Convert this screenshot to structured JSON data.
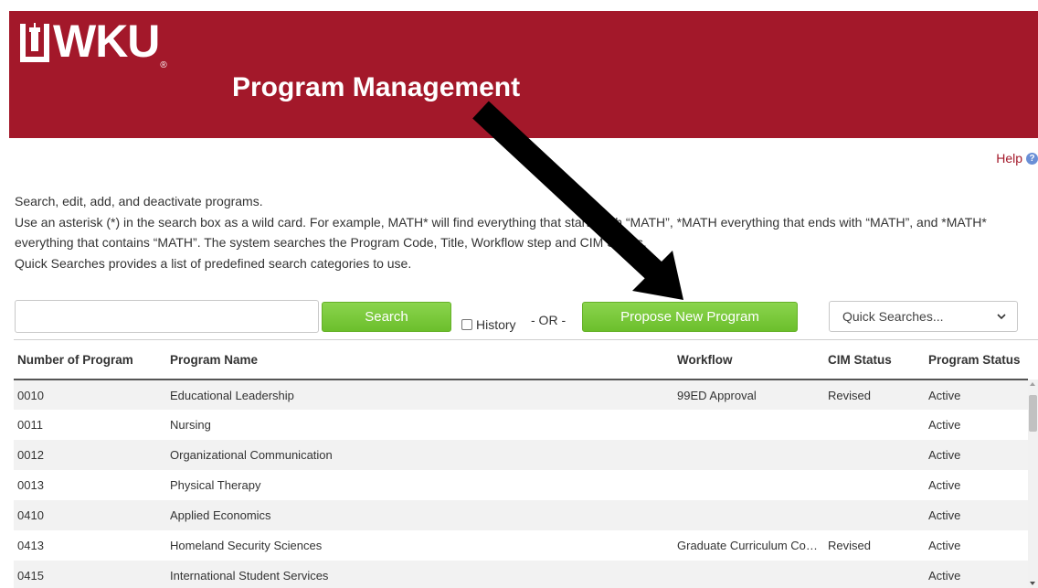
{
  "header": {
    "logo_text": "WKU",
    "logo_reg": "®",
    "title": "Program Management"
  },
  "help": {
    "label": "Help",
    "icon_glyph": "?"
  },
  "intro": {
    "line1": "Search, edit, add, and deactivate programs.",
    "line2": "Use an asterisk (*) in the search box as a wild card. For example, MATH* will find everything that starts with “MATH”, *MATH everything that ends with “MATH”, and *MATH* everything that contains “MATH”. The system searches the Program Code, Title, Workflow step and CIM Status.",
    "line3": "Quick Searches provides a list of predefined search categories to use."
  },
  "search": {
    "value": "",
    "button_label": "Search",
    "history_label": "History",
    "history_checked": false,
    "or_label": "- OR -",
    "propose_label": "Propose New Program",
    "quick_searches_label": "Quick Searches..."
  },
  "table": {
    "headers": [
      "Number of Program",
      "Program Name",
      "Workflow",
      "CIM Status",
      "Program Status"
    ],
    "rows": [
      [
        "0010",
        "Educational Leadership",
        "99ED Approval",
        "Revised",
        "Active"
      ],
      [
        "0011",
        "Nursing",
        "",
        "",
        "Active"
      ],
      [
        "0012",
        "Organizational Communication",
        "",
        "",
        "Active"
      ],
      [
        "0013",
        "Physical Therapy",
        "",
        "",
        "Active"
      ],
      [
        "0410",
        "Applied Economics",
        "",
        "",
        "Active"
      ],
      [
        "0413",
        "Homeland Security Sciences",
        "Graduate Curriculum Committee",
        "Revised",
        "Active"
      ],
      [
        "0415",
        "International Student Services",
        "",
        "",
        "Active"
      ]
    ]
  },
  "colors": {
    "brand_red": "#A3182A",
    "button_green": "#6cbf2c",
    "arrow": "#000000"
  }
}
